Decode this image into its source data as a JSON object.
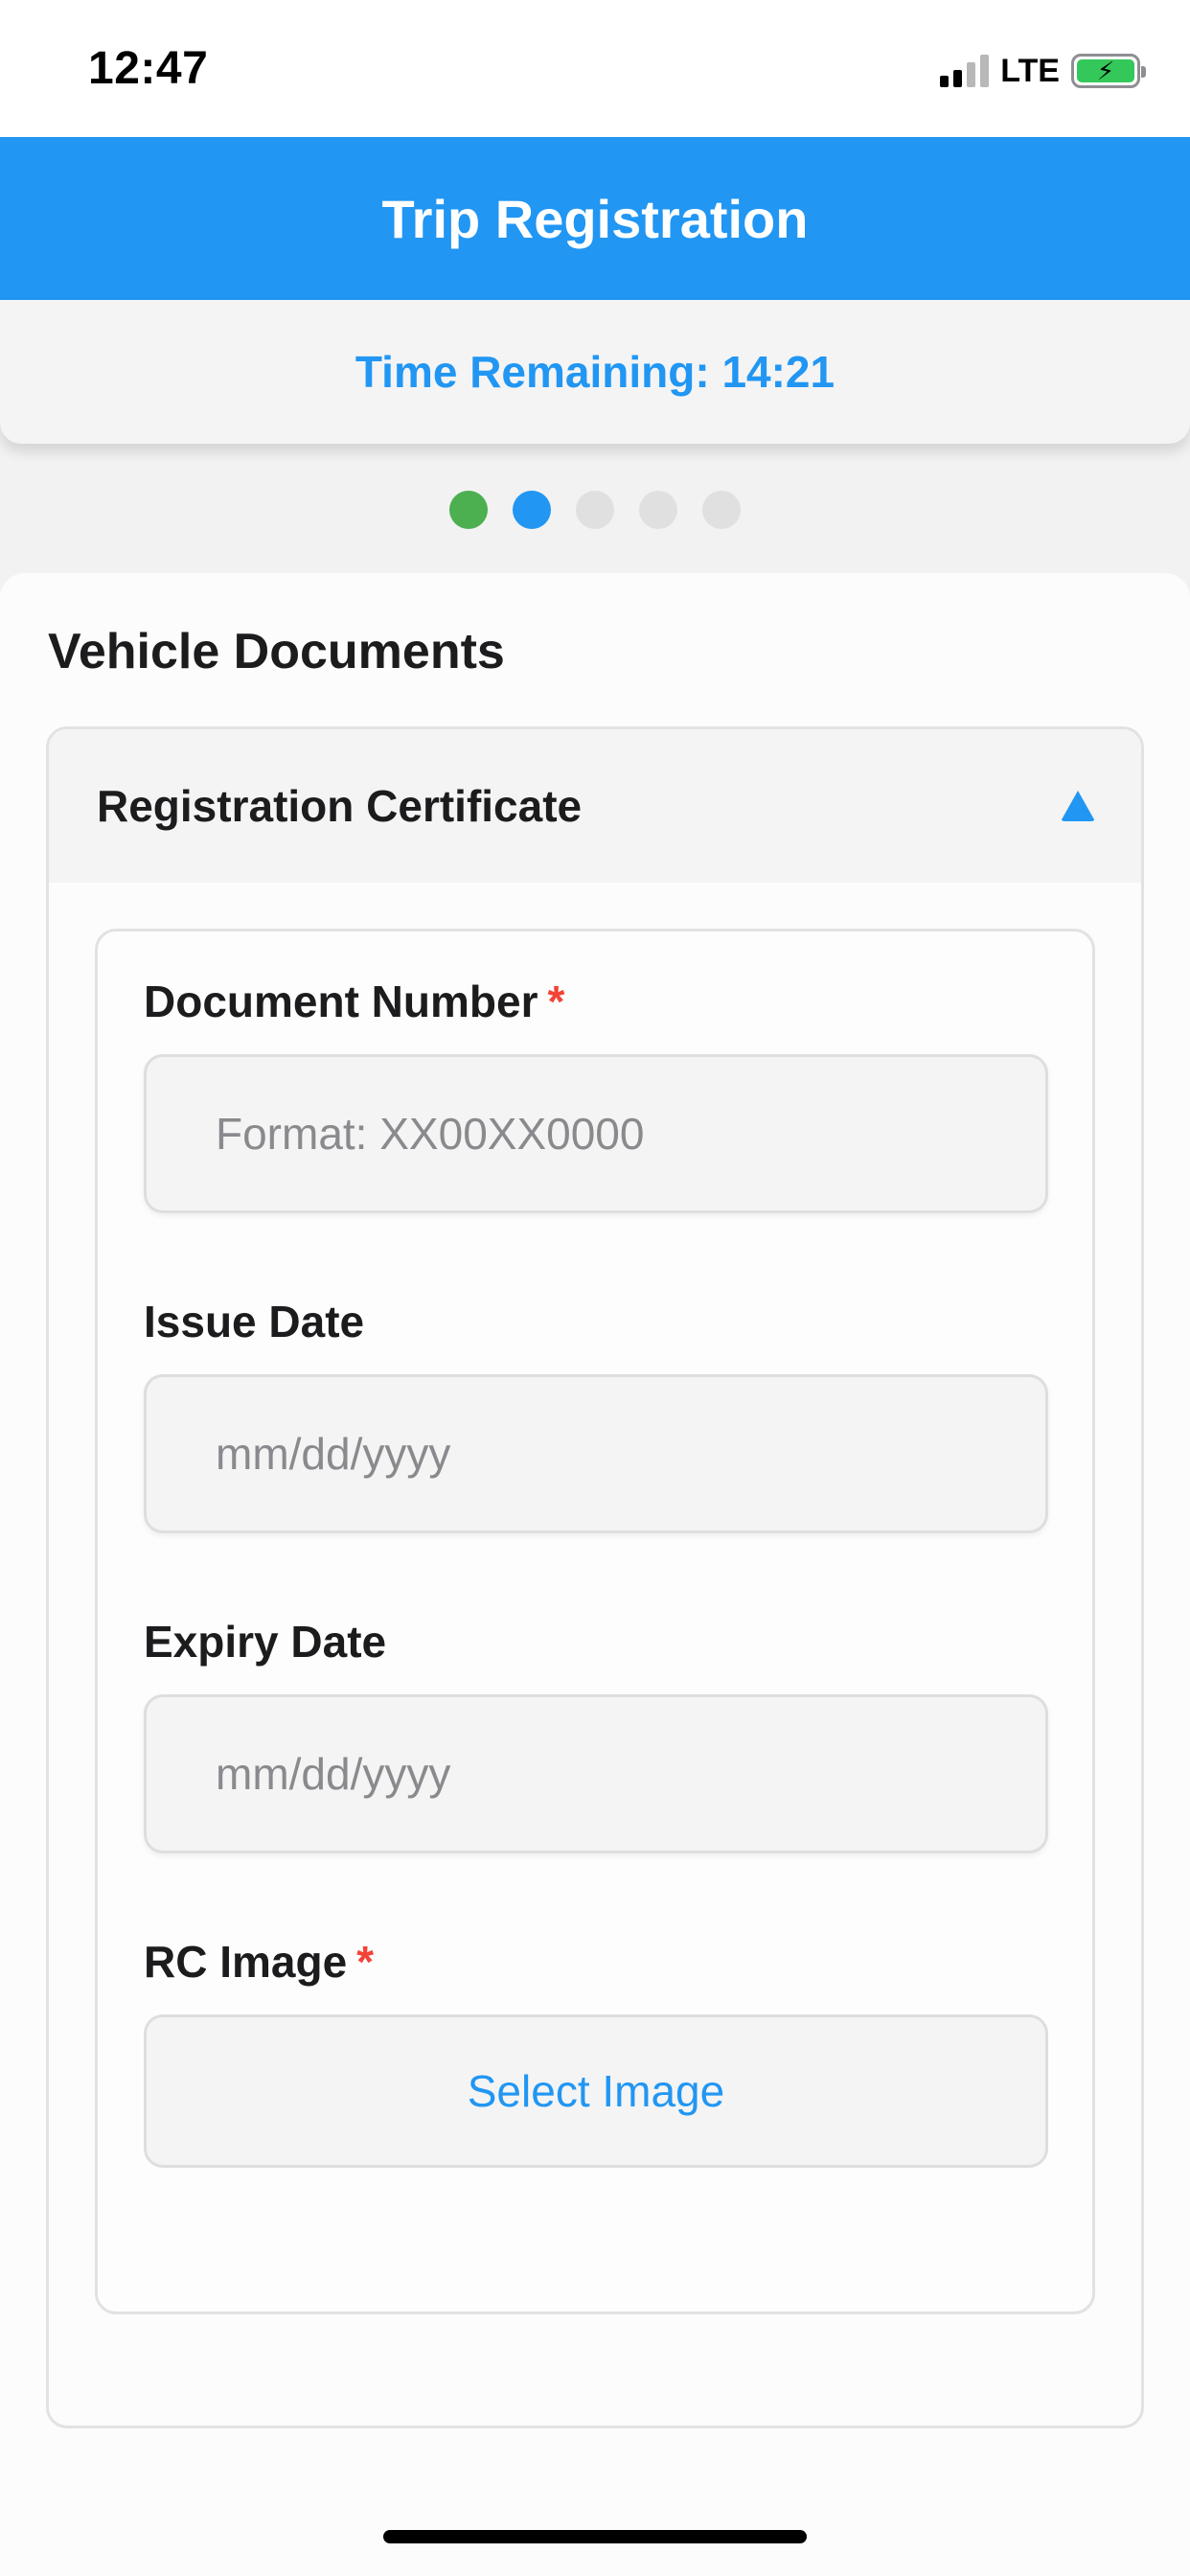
{
  "status_bar": {
    "time": "12:47",
    "network": "LTE",
    "battery_charging": true,
    "battery_color": "#34c759"
  },
  "header": {
    "title": "Trip Registration",
    "color": "#2196f3"
  },
  "timer": {
    "text": "Time Remaining: 14:21"
  },
  "steps": {
    "total": 5,
    "current": 2,
    "completed": 1,
    "colors": {
      "completed": "#4caf50",
      "active": "#2196f3",
      "pending": "#e0e0e0"
    }
  },
  "section": {
    "title": "Vehicle Documents"
  },
  "accordion": {
    "title": "Registration Certificate",
    "expanded": true,
    "toggle_icon": "caret-up-icon"
  },
  "form": {
    "document_number": {
      "label": "Document Number",
      "required_mark": "*",
      "value": "",
      "placeholder": "Format: XX00XX0000"
    },
    "issue_date": {
      "label": "Issue Date",
      "value": "",
      "placeholder": "mm/dd/yyyy"
    },
    "expiry_date": {
      "label": "Expiry Date",
      "value": "",
      "placeholder": "mm/dd/yyyy"
    },
    "rc_image": {
      "label": "RC Image",
      "required_mark": "*",
      "button_label": "Select Image"
    }
  }
}
